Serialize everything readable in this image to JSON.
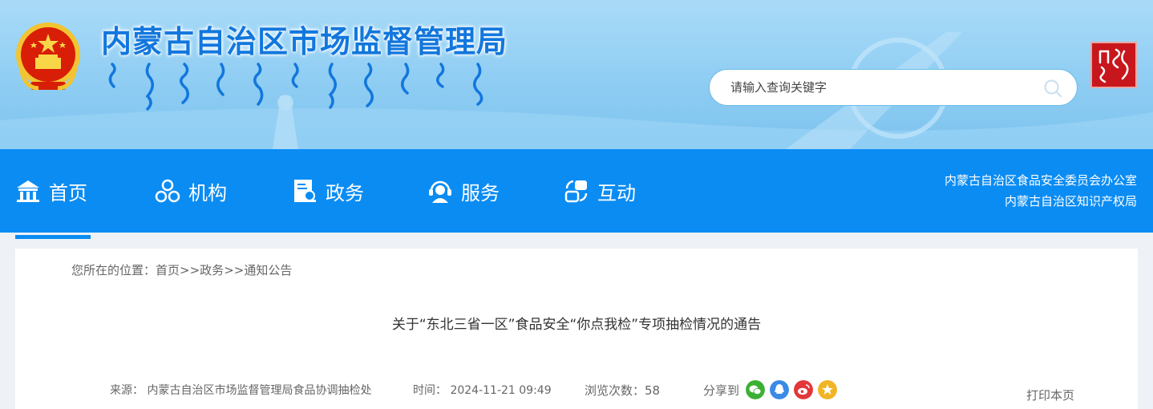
{
  "header": {
    "site_title": "内蒙古自治区市场监督管理局",
    "search": {
      "placeholder": "请输入查询关键字"
    }
  },
  "nav": {
    "items": [
      {
        "label": "首页",
        "icon": "home-icon"
      },
      {
        "label": "机构",
        "icon": "org-icon"
      },
      {
        "label": "政务",
        "icon": "gov-icon"
      },
      {
        "label": "服务",
        "icon": "service-icon"
      },
      {
        "label": "互动",
        "icon": "interact-icon"
      }
    ],
    "links": [
      "内蒙古自治区食品安全委员会办公室",
      "内蒙古自治区知识产权局"
    ]
  },
  "breadcrumb": {
    "prefix": "您所在的位置：",
    "items": [
      "首页",
      "政务",
      "通知公告"
    ],
    "separator": ">>"
  },
  "article": {
    "title": "关于“东北三省一区”食品安全“你点我检”专项抽检情况的通告",
    "source_label": "来源：",
    "source": "内蒙古自治区市场监督管理局食品协调抽检处",
    "time_label": "时间：",
    "time": "2024-11-21 09:49",
    "views_label": "浏览次数：",
    "views": "58",
    "share_label": "分享到",
    "print_label": "打印本页"
  },
  "colors": {
    "nav_bg": "#0b8cf3",
    "title_blue": "#1277dd",
    "header_sky": "#8fcdf3",
    "seal_red": "#c8161d"
  }
}
